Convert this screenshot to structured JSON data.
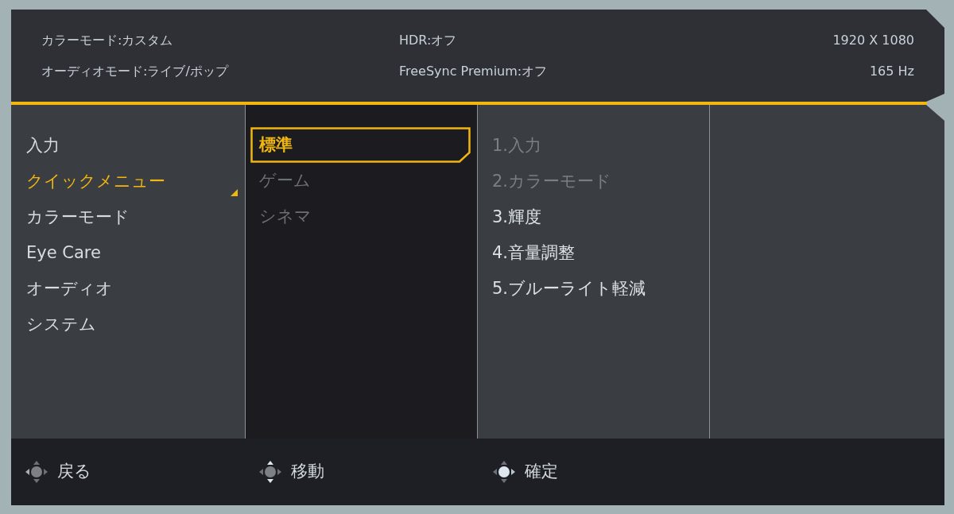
{
  "status": {
    "rows": [
      [
        "カラーモード:カスタム",
        "HDR:オフ",
        "1920 X 1080"
      ],
      [
        "オーディオモード:ライブ/ポップ",
        "FreeSync Premium:オフ",
        "165 Hz"
      ]
    ]
  },
  "menu": {
    "items": [
      {
        "label": "入力",
        "selected": false
      },
      {
        "label": "クイックメニュー",
        "selected": true
      },
      {
        "label": "カラーモード",
        "selected": false
      },
      {
        "label": "Eye Care",
        "selected": false
      },
      {
        "label": "オーディオ",
        "selected": false
      },
      {
        "label": "システム",
        "selected": false
      }
    ]
  },
  "submenu": {
    "items": [
      {
        "label": "標準",
        "selected": true
      },
      {
        "label": "ゲーム",
        "selected": false
      },
      {
        "label": "シネマ",
        "selected": false
      }
    ]
  },
  "options": {
    "items": [
      {
        "label": "1.入力",
        "disabled": true
      },
      {
        "label": "2.カラーモード",
        "disabled": true
      },
      {
        "label": "3.輝度",
        "disabled": false
      },
      {
        "label": "4.音量調整",
        "disabled": false
      },
      {
        "label": "5.ブルーライト軽減",
        "disabled": false
      }
    ]
  },
  "footer": [
    {
      "label": "戻る",
      "kind": "back"
    },
    {
      "label": "移動",
      "kind": "move"
    },
    {
      "label": "確定",
      "kind": "confirm"
    }
  ]
}
